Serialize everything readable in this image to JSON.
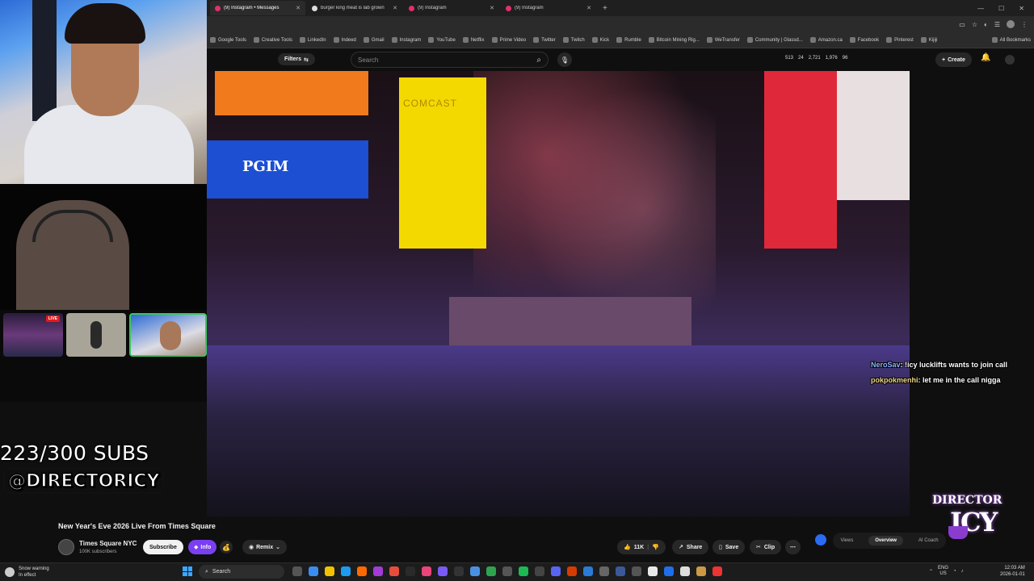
{
  "browser": {
    "tabs": [
      {
        "label": "(9) Instagram • Messages",
        "active": true
      },
      {
        "label": "burger king meat is lab grown",
        "active": false
      },
      {
        "label": "(9) Instagram",
        "active": false
      },
      {
        "label": "(9) Instagram",
        "active": false
      }
    ],
    "bookmarks": [
      "Google Tools",
      "Creative Tools",
      "LinkedIn",
      "Indeed",
      "Gmail",
      "Instagram",
      "YouTube",
      "Netflix",
      "Prime Video",
      "Twitter",
      "Twitch",
      "Kick",
      "Rumble",
      "Bitcoin Mining Rig...",
      "WeTransfer",
      "Community | Glassd...",
      "Amazon.ca",
      "Facebook",
      "Pinterest",
      "Kijiji"
    ],
    "all_bookmarks": "All Bookmarks"
  },
  "youtube": {
    "filters_label": "Filters",
    "search_placeholder": "Search",
    "stats": [
      "513",
      "24",
      "2,721",
      "1,976",
      "96"
    ],
    "create_label": "Create",
    "video_signs": {
      "pgim": "PGIM",
      "comcast": "COMCAST"
    },
    "video_title": "New Year's Eve 2026 Live From Times Square",
    "channel_name": "Times Square NYC",
    "channel_subs": "100K subscribers",
    "subscribe_label": "Subscribe",
    "info_label": "Info",
    "remix_label": "Remix",
    "like_count": "11K",
    "share_label": "Share",
    "save_label": "Save",
    "clip_label": "Clip",
    "more_label": "⋯",
    "overview_tabs": [
      "Views",
      "Overview",
      "AI Coach"
    ]
  },
  "stream": {
    "sub_goal": "223/300 SUBS",
    "handle": "@DIRECTORICY",
    "live_badge": "LIVE",
    "logo_top": "DIRECTOR",
    "logo_bottom": "ICY",
    "chat": [
      {
        "user": "NeroSav",
        "text": ": !icy lucklifts wants to join call"
      },
      {
        "user": "pokpokmenhi",
        "text": ": let me in the call nigga"
      }
    ]
  },
  "taskbar": {
    "weather_title": "Snow warning",
    "weather_sub": "In effect",
    "search_label": "Search",
    "lang_top": "ENG",
    "lang_bottom": "US",
    "time": "12:03 AM",
    "date": "2026-01-01"
  }
}
